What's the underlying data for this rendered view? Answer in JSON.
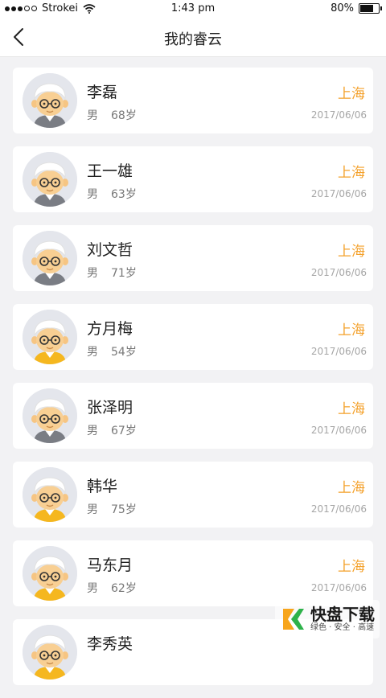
{
  "status": {
    "carrier": "Strokei",
    "time": "1:43 pm",
    "battery": "80%",
    "battery_level": 0.8,
    "signal_icon": "signal-dots-icon",
    "wifi_icon": "wifi-icon"
  },
  "nav": {
    "title": "我的睿云",
    "back_icon": "chevron-left-icon"
  },
  "people": [
    {
      "name": "李磊",
      "gender": "男",
      "age": "68岁",
      "city": "上海",
      "date": "2017/06/06",
      "variant": "gray"
    },
    {
      "name": "王一雄",
      "gender": "男",
      "age": "63岁",
      "city": "上海",
      "date": "2017/06/06",
      "variant": "gray"
    },
    {
      "name": "刘文哲",
      "gender": "男",
      "age": "71岁",
      "city": "上海",
      "date": "2017/06/06",
      "variant": "gray"
    },
    {
      "name": "方月梅",
      "gender": "男",
      "age": "54岁",
      "city": "上海",
      "date": "2017/06/06",
      "variant": "yellow"
    },
    {
      "name": "张泽明",
      "gender": "男",
      "age": "67岁",
      "city": "上海",
      "date": "2017/06/06",
      "variant": "gray"
    },
    {
      "name": "韩华",
      "gender": "男",
      "age": "75岁",
      "city": "上海",
      "date": "2017/06/06",
      "variant": "yellow"
    },
    {
      "name": "马东月",
      "gender": "男",
      "age": "62岁",
      "city": "上海",
      "date": "2017/06/06",
      "variant": "yellow"
    },
    {
      "name": "李秀英",
      "gender": "",
      "age": "",
      "city": "",
      "date": "",
      "variant": "yellow"
    }
  ],
  "watermark": {
    "line1": "快盘下载",
    "line2": "绿色 · 安全 · 高速"
  },
  "colors": {
    "accent": "#f4a12b",
    "background": "#f2f2f4",
    "card": "#ffffff",
    "date": "#a6a6a6"
  }
}
